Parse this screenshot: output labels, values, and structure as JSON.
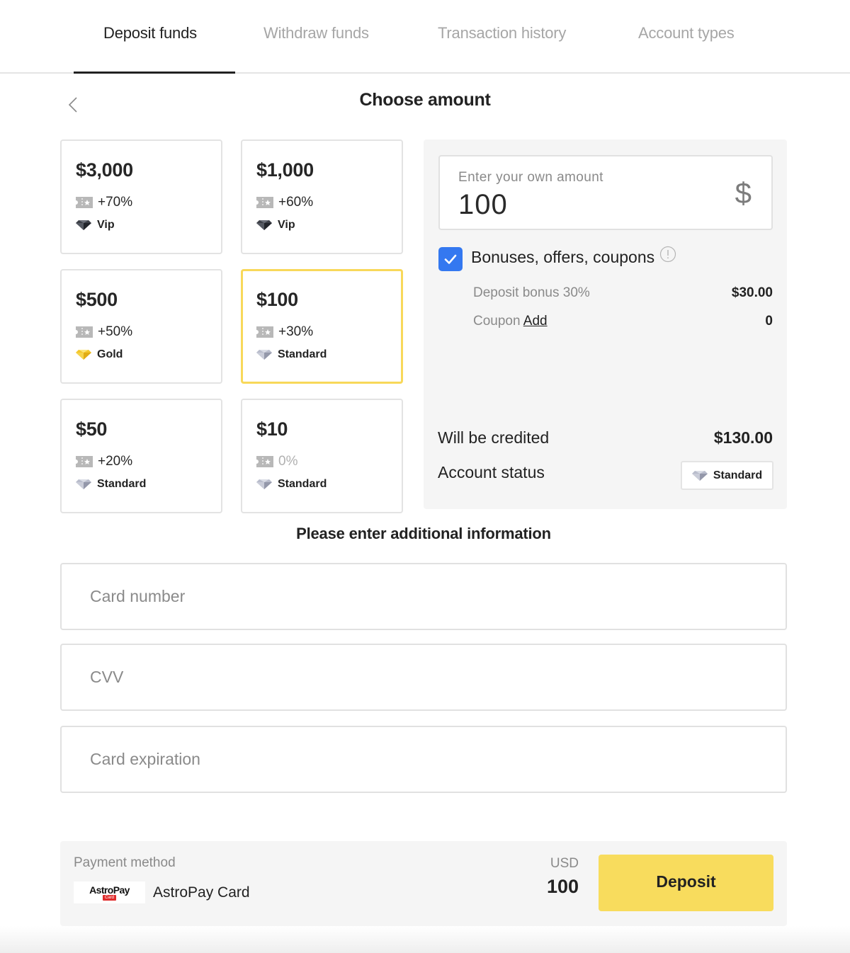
{
  "tabs": [
    {
      "label": "Deposit funds",
      "active": true
    },
    {
      "label": "Withdraw funds",
      "active": false
    },
    {
      "label": "Transaction history",
      "active": false
    },
    {
      "label": "Account types",
      "active": false
    }
  ],
  "page_title": "Choose amount",
  "back_icon": "chevron-left-icon",
  "amount_cards": [
    {
      "amount": "$3,000",
      "bonus": "+70%",
      "tier": "Vip",
      "tier_icon": "diamond-dark-icon",
      "selected": false
    },
    {
      "amount": "$1,000",
      "bonus": "+60%",
      "tier": "Vip",
      "tier_icon": "diamond-dark-icon",
      "selected": false
    },
    {
      "amount": "$500",
      "bonus": "+50%",
      "tier": "Gold",
      "tier_icon": "diamond-gold-icon",
      "selected": false
    },
    {
      "amount": "$100",
      "bonus": "+30%",
      "tier": "Standard",
      "tier_icon": "diamond-silver-icon",
      "selected": true
    },
    {
      "amount": "$50",
      "bonus": "+20%",
      "tier": "Standard",
      "tier_icon": "diamond-silver-icon",
      "selected": false
    },
    {
      "amount": "$10",
      "bonus": "0%",
      "tier": "Standard",
      "tier_icon": "diamond-silver-icon",
      "selected": false
    }
  ],
  "summary": {
    "own_amount_label": "Enter your own amount",
    "own_amount_value": "100",
    "currency_symbol": "$",
    "bonuses_label": "Bonuses, offers, coupons",
    "bonuses_checked": true,
    "deposit_bonus_label": "Deposit bonus 30%",
    "deposit_bonus_value": "$30.00",
    "coupon_label": "Coupon",
    "coupon_link": "Add",
    "coupon_value": "0",
    "credited_label": "Will be credited",
    "credited_value": "$130.00",
    "status_label": "Account status",
    "status_value": "Standard"
  },
  "additional_info": {
    "title": "Please enter additional information",
    "card_number_placeholder": "Card number",
    "cvv_placeholder": "CVV",
    "card_expiration_placeholder": "Card expiration"
  },
  "footer": {
    "payment_method_label": "Payment method",
    "logo_text": "AstroPay",
    "logo_sub": "Card",
    "payment_method_name": "AstroPay Card",
    "currency": "USD",
    "total": "100",
    "deposit_label": "Deposit"
  },
  "colors": {
    "accent_yellow": "#f8dc5d",
    "selected_border": "#f8d85a",
    "checkbox_blue": "#3478f0",
    "panel_bg": "#f5f5f5"
  }
}
